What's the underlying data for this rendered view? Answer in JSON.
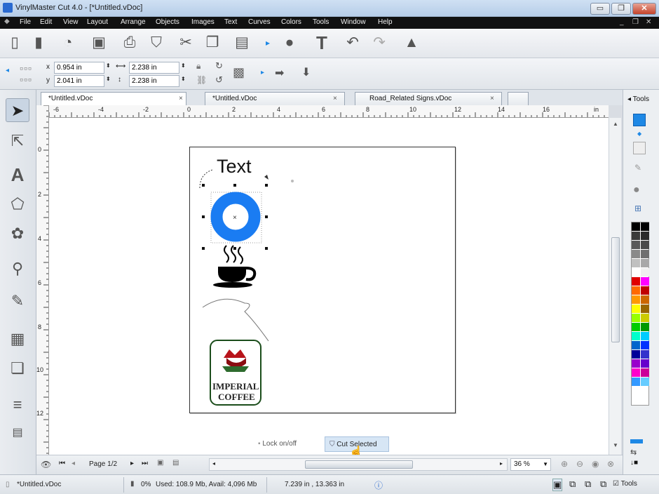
{
  "window": {
    "title": "VinylMaster Cut 4.0 - [*Untitled.vDoc]",
    "minimize": "▭",
    "restore": "❐",
    "close": "✕",
    "mdi_minimize": "_",
    "mdi_restore": "❐",
    "mdi_close": "✕"
  },
  "menu": [
    "File",
    "Edit",
    "View",
    "Layout",
    "Arrange",
    "Images",
    "Objects",
    "Images",
    "Text",
    "Curves",
    "Colors",
    "Tools",
    "Window",
    "Help"
  ],
  "menu_visible": [
    "File",
    "Edit",
    "View",
    "Layout",
    "Arrange",
    "Objects",
    "Images",
    "Text",
    "Curves",
    "Colors",
    "Tools",
    "Window",
    "Help"
  ],
  "props": {
    "x_label": "x",
    "x_value": "0.954 in",
    "y_label": "y",
    "y_value": "2.041 in",
    "w_value": "2.238 in",
    "h_value": "2.238 in"
  },
  "tabs": [
    {
      "label": "*Untitled.vDoc"
    },
    {
      "label": "*Untitled.vDoc"
    },
    {
      "label": "Road_Related Signs.vDoc"
    }
  ],
  "tab_close": "×",
  "ruler_h": [
    "-6",
    "-4",
    "-2",
    "0",
    "2",
    "4",
    "6",
    "8",
    "10",
    "12",
    "14",
    "16",
    "in"
  ],
  "ruler_v": [
    "0",
    "2",
    "4",
    "6",
    "8",
    "10",
    "12"
  ],
  "canvas": {
    "text_object": "Text",
    "logo_line1": "IMPERIAL",
    "logo_line2": "COFFEE"
  },
  "bottom_actions": {
    "lock": "Lock on/off",
    "cut": "Cut Selected"
  },
  "nav": {
    "page": "Page 1/2",
    "zoom": "36 %"
  },
  "status": {
    "file": "*Untitled.vDoc",
    "progress": "0%",
    "memory": "Used: 108.9 Mb, Avail: 4,096 Mb",
    "coords": "7.239 in , 13.363 in",
    "tools": "Tools"
  },
  "right_panel": {
    "header": "Tools"
  },
  "palette": [
    "#000000",
    "#000000",
    "#3a3a3a",
    "#2b2b2b",
    "#5a5a5a",
    "#4a4a4a",
    "#8a8a8a",
    "#707070",
    "#c0c0c0",
    "#a8a8a8",
    "#ffffff",
    "#f0f0f0",
    "#e00000",
    "#ff00ff",
    "#ff6a00",
    "#c00000",
    "#ff9900",
    "#cc6600",
    "#ffff00",
    "#996600",
    "#99ff00",
    "#cccc00",
    "#00cc00",
    "#009900",
    "#00ffcc",
    "#00ccff",
    "#0066cc",
    "#0033ff",
    "#000099",
    "#3333cc",
    "#9900cc",
    "#6600cc",
    "#ff00cc",
    "#cc0099",
    "#3399ff",
    "#66ccff"
  ],
  "colors": {
    "accent_blue": "#1e88e5",
    "donut": "#1a7cf2",
    "menubar": "#111111"
  }
}
